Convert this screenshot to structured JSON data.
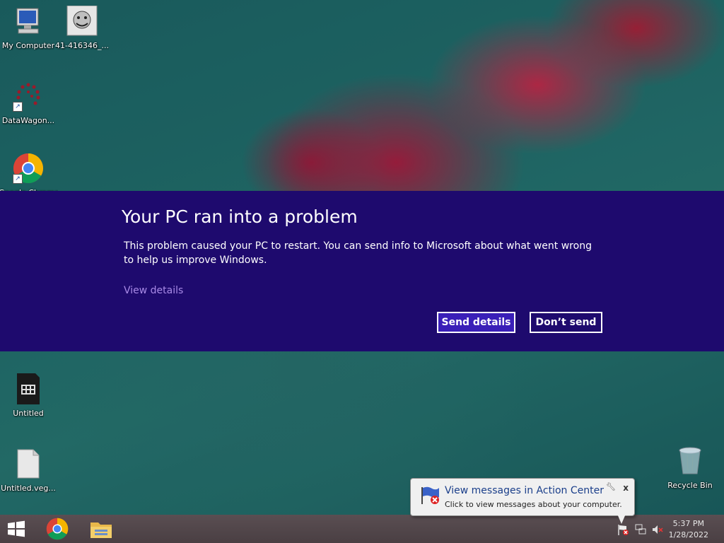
{
  "desktop": {
    "icons": [
      {
        "label": "My Computer",
        "icon": "computer-icon"
      },
      {
        "label": "41-416346_...",
        "icon": "image-thumbnail-icon"
      },
      {
        "label": "DataWagon...",
        "icon": "datawagon-icon"
      },
      {
        "label": "Google Chrome",
        "icon": "chrome-icon"
      },
      {
        "label": "Untitled",
        "icon": "video-file-icon"
      },
      {
        "label": "Untitled.veg...",
        "icon": "file-icon"
      },
      {
        "label": "Recycle Bin",
        "icon": "recycle-bin-icon"
      }
    ]
  },
  "error": {
    "title": "Your PC ran into a problem",
    "message": "This problem caused your PC to restart. You can send info to Microsoft about what went wrong to help us improve Windows.",
    "view_details": "View details",
    "send_label": "Send details",
    "dont_send_label": "Don’t send",
    "bg_color": "#1e0a6e"
  },
  "balloon": {
    "title": "View messages in Action Center",
    "text": "Click to view messages about your computer.",
    "close": "x"
  },
  "taskbar": {
    "items": [
      "start-icon",
      "chrome-icon",
      "file-explorer-icon"
    ],
    "time": "5:37 PM",
    "date": "1/28/2022"
  }
}
